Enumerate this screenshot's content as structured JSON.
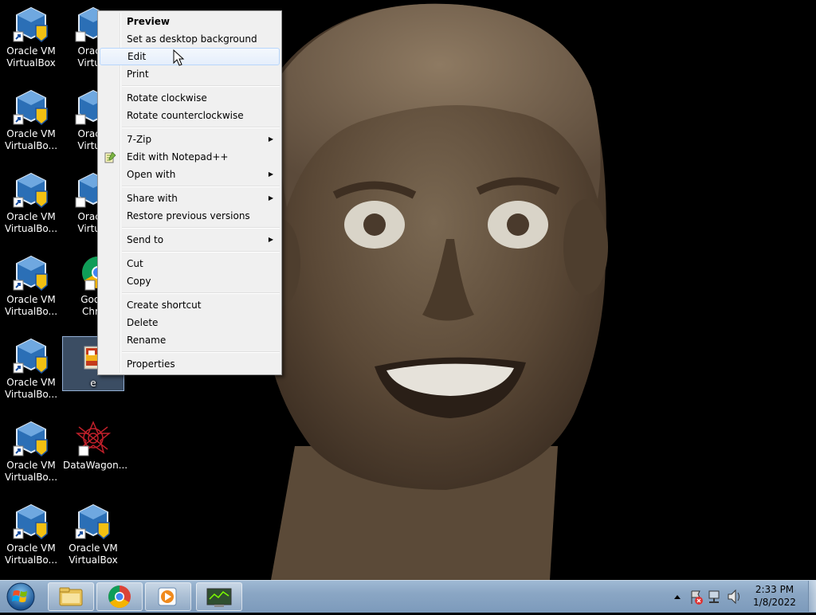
{
  "desktop": {
    "icons": [
      {
        "label": "Oracle VM\nVirtualBox"
      },
      {
        "label": "Oracle VM\nVirtualBo..."
      },
      {
        "label": "Oracle VM\nVirtualBo..."
      },
      {
        "label": "Oracle VM\nVirtualBo..."
      },
      {
        "label": "Oracle VM\nVirtualBo..."
      },
      {
        "label": "Oracle VM\nVirtualBo..."
      },
      {
        "label": "Oracle VM\nVirtualBo..."
      },
      {
        "label": "Oracle\nVirtual"
      },
      {
        "label": "Oracle\nVirtual"
      },
      {
        "label": "Oracle\nVirtual"
      },
      {
        "label": "Goog\nChro"
      },
      {
        "label": "e"
      },
      {
        "label": "DataWagon..."
      },
      {
        "label": "Oracle VM\nVirtualBox"
      }
    ]
  },
  "context_menu": {
    "items": [
      {
        "label": "Preview",
        "bold": true
      },
      {
        "label": "Set as desktop background"
      },
      {
        "label": "Edit",
        "hover": true
      },
      {
        "label": "Print"
      },
      {
        "label": "Rotate clockwise"
      },
      {
        "label": "Rotate counterclockwise"
      },
      {
        "label": "7-Zip",
        "submenu": true
      },
      {
        "label": "Edit with Notepad++",
        "icon": "notepad-plus-plus-icon"
      },
      {
        "label": "Open with",
        "submenu": true
      },
      {
        "label": "Share with",
        "submenu": true
      },
      {
        "label": "Restore previous versions"
      },
      {
        "label": "Send to",
        "submenu": true
      },
      {
        "label": "Cut"
      },
      {
        "label": "Copy"
      },
      {
        "label": "Create shortcut"
      },
      {
        "label": "Delete"
      },
      {
        "label": "Rename"
      },
      {
        "label": "Properties"
      }
    ]
  },
  "taskbar": {
    "start_icon": "windows-start-orb-icon",
    "pinned": [
      "folder-explorer-icon",
      "chrome-icon",
      "media-player-icon",
      "monitor-app-icon"
    ],
    "tray_icons": [
      "show-hidden-icons-chevron",
      "action-center-flag-icon",
      "network-icon",
      "volume-icon"
    ],
    "time": "2:33 PM",
    "date": "1/8/2022"
  },
  "colors": {
    "menu_bg": "#f0f0f0",
    "menu_hover": "#e5eefb",
    "taskbar": "#8aa6c4",
    "desktop_bg": "#000000"
  }
}
